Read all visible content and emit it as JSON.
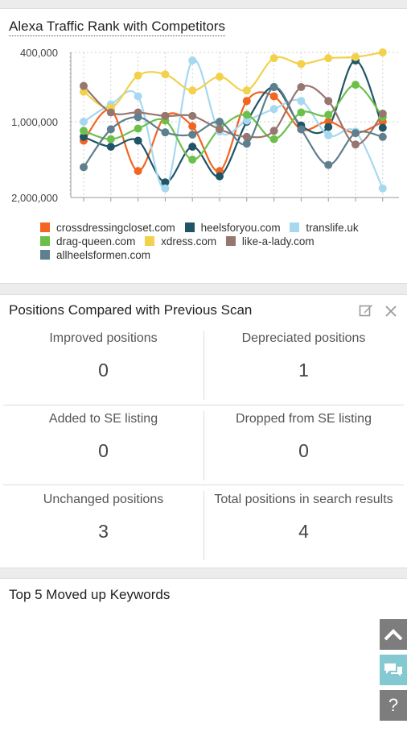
{
  "chart_card": {
    "title": "Alexa Traffic Rank with Competitors"
  },
  "chart_data": {
    "type": "line",
    "title": "Alexa Traffic Rank with Competitors",
    "y_axis": {
      "reversed": true,
      "ticks": [
        "400,000",
        "1,000,000",
        "2,000,000"
      ],
      "ylim": [
        400000,
        2000000
      ]
    },
    "x_count": 12,
    "grid": true,
    "legend_position": "bottom",
    "series": [
      {
        "name": "crossdressingcloset.com",
        "color": "#f26522",
        "values": [
          1250000,
          900000,
          1650000,
          950000,
          1060000,
          1650000,
          820000,
          780000,
          1100000,
          1000000,
          1150000,
          1000000
        ]
      },
      {
        "name": "heelsforyou.com",
        "color": "#1f5566",
        "values": [
          1200000,
          1330000,
          1250000,
          1800000,
          1330000,
          1720000,
          1000000,
          700000,
          1050000,
          1070000,
          470000,
          1080000
        ]
      },
      {
        "name": "translife.uk",
        "color": "#a6d8f0",
        "values": [
          1000000,
          850000,
          780000,
          1880000,
          470000,
          1130000,
          990000,
          890000,
          820000,
          1180000,
          1130000,
          1880000
        ]
      },
      {
        "name": "drag-queen.com",
        "color": "#6cc04a",
        "values": [
          1120000,
          1230000,
          1090000,
          990000,
          1500000,
          1090000,
          940000,
          1230000,
          920000,
          940000,
          680000,
          960000
        ]
      },
      {
        "name": "xdress.com",
        "color": "#f2d14d",
        "values": [
          740000,
          880000,
          600000,
          590000,
          730000,
          610000,
          730000,
          450000,
          500000,
          450000,
          440000,
          400000
        ]
      },
      {
        "name": "like-a-lady.com",
        "color": "#97766f",
        "values": [
          690000,
          920000,
          920000,
          950000,
          950000,
          1100000,
          1200000,
          1120000,
          700000,
          820000,
          1300000,
          930000
        ]
      },
      {
        "name": "allheelsformen.com",
        "color": "#5e7f8d",
        "values": [
          1600000,
          1100000,
          960000,
          1140000,
          1170000,
          1000000,
          1290000,
          700000,
          1100000,
          1570000,
          1150000,
          1200000
        ]
      }
    ]
  },
  "positions_card": {
    "title": "Positions Compared with Previous Scan",
    "cells": [
      {
        "label": "Improved positions",
        "value": "0"
      },
      {
        "label": "Depreciated positions",
        "value": "1"
      },
      {
        "label": "Added to SE listing",
        "value": "0"
      },
      {
        "label": "Dropped from SE listing",
        "value": "0"
      },
      {
        "label": "Unchanged positions",
        "value": "3"
      },
      {
        "label": "Total positions in search results",
        "value": "4"
      }
    ],
    "icons": [
      "edit-icon",
      "close-icon"
    ]
  },
  "keywords_card": {
    "title": "Top 5 Moved up Keywords"
  },
  "side_buttons": {
    "top_icon": "chevron-up-icon",
    "chat_icon": "chat-icon",
    "help_label": "?"
  }
}
